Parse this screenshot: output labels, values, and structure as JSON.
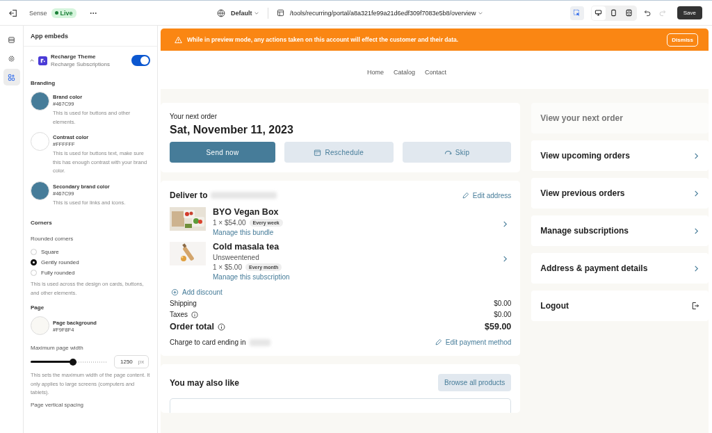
{
  "topbar": {
    "store": "Sense",
    "status": "Live",
    "more": "•••",
    "theme": "Default",
    "url": "/tools/recurring/portal/a8a321fe99a21d6edf309f7083e5b8/overview",
    "inspect_selected": true,
    "devices": [
      {
        "kind": "desktop",
        "selected": true
      },
      {
        "kind": "mobile",
        "selected": false
      },
      {
        "kind": "fit",
        "selected": false
      }
    ],
    "save": "Save"
  },
  "rail": [
    {
      "kind": "sections",
      "selected": false
    },
    {
      "kind": "settings",
      "selected": false
    },
    {
      "kind": "apps",
      "selected": true
    }
  ],
  "panel": {
    "title": "App embeds",
    "embed": {
      "name": "Recharge Theme",
      "app": "Recharge Subscriptions",
      "expanded": true,
      "enabled": true
    },
    "branding": {
      "heading": "Branding",
      "colors": [
        {
          "label": "Brand color",
          "value": "#467C99",
          "color": "#467c99",
          "description": "This is used for buttons and other elements."
        },
        {
          "label": "Contrast color",
          "value": "#FFFFFF",
          "color": "#ffffff",
          "description": "This is used for buttons text, make sure this has enough contrast with your brand color."
        },
        {
          "label": "Secondary brand color",
          "value": "#467C99",
          "color": "#467c99",
          "description": "This is used for links and icons."
        }
      ]
    },
    "corners": {
      "heading": "Corners",
      "label": "Rounded corners",
      "options": [
        {
          "label": "Square",
          "selected": false
        },
        {
          "label": "Gently rounded",
          "selected": true
        },
        {
          "label": "Fully rounded",
          "selected": false
        }
      ],
      "description": "This is used across the design on cards, buttons, and other elements."
    },
    "page": {
      "heading": "Page",
      "background": {
        "label": "Page background",
        "value": "#F9F8F4",
        "color": "#f9f8f4"
      },
      "width": {
        "label": "Maximum page width",
        "level": 0.55,
        "value": "1250",
        "unit": "px",
        "description": "This sets the maximum width of the page content. It only applies to large screens (computers and tablets)."
      },
      "spacing_label": "Page vertical spacing"
    }
  },
  "banner": {
    "message": "While in preview mode, any actions taken on this account will effect the customer and their data.",
    "dismiss": "Dismiss"
  },
  "nav": [
    "Home",
    "Catalog",
    "Contact"
  ],
  "next_order": {
    "label": "Your next order",
    "date": "Sat, November 11, 2023",
    "buttons": [
      {
        "label": "Send now",
        "kind": "primary"
      },
      {
        "label": "Reschedule",
        "kind": "reschedule"
      },
      {
        "label": "Skip",
        "kind": "skip"
      }
    ]
  },
  "delivery": {
    "title": "Deliver to",
    "edit": "Edit address",
    "items": [
      {
        "name": "BYO Vegan Box",
        "price": "1 × $54.00",
        "frequency": "Every week",
        "link": "Manage this bundle",
        "kind": "box"
      },
      {
        "name": "Cold masala tea",
        "variant": "Unsweentened",
        "price": "1 × $5.00",
        "frequency": "Every month",
        "link": "Manage this subscription",
        "kind": "bottle"
      }
    ],
    "discount": "Add discount",
    "summary": [
      {
        "label": "Shipping",
        "value": "$0.00",
        "info": false
      },
      {
        "label": "Taxes",
        "value": "$0.00",
        "info": true
      }
    ],
    "total": {
      "label": "Order total",
      "value": "$59.00"
    },
    "charge": "Charge to card ending in",
    "edit_payment": "Edit payment method"
  },
  "also_like": {
    "title": "You may also like",
    "button": "Browse all products"
  },
  "menu": [
    {
      "label": "View your next order",
      "selected": true,
      "kind": "link"
    },
    {
      "label": "View upcoming orders",
      "selected": false,
      "kind": "link"
    },
    {
      "label": "View previous orders",
      "selected": false,
      "kind": "link"
    },
    {
      "label": "Manage subscriptions",
      "selected": false,
      "kind": "link"
    },
    {
      "label": "Address & payment details",
      "selected": false,
      "kind": "link"
    },
    {
      "label": "Logout",
      "selected": false,
      "kind": "logout"
    }
  ]
}
